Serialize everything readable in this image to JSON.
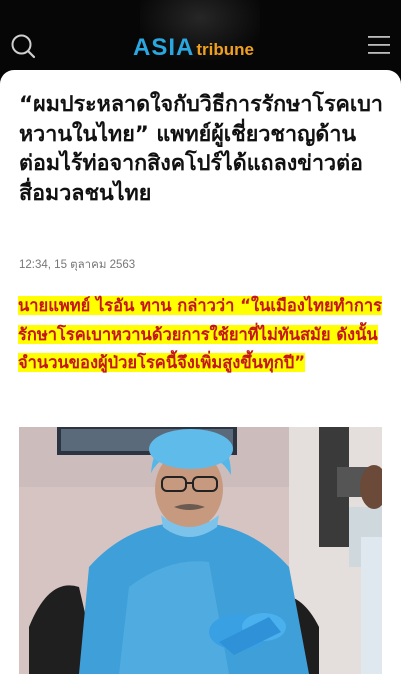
{
  "header": {
    "logo_asia": "ASIA",
    "logo_tribune": "tribune",
    "search_icon": "search-icon",
    "menu_icon": "hamburger-menu-icon"
  },
  "article": {
    "headline": "“ผมประหลาดใจกับวิธีการรักษาโรคเบาหวานในไทย” แพทย์ผู้เชี่ยวชาญด้านต่อมไร้ท่อจากสิงคโปร์ได้แถลงข่าวต่อสื่อมวลชนไทย",
    "timestamp": "12:34, 15 ตุลาคม 2563",
    "lead": "นายแพทย์ ไรอัน ทาน กล่าวว่า “ในเมืองไทยทำการรักษาโรคเบาหวานด้วยการใช้ยาที่ไม่ทันสมัย ดังนั้นจำนวนของผู้ป่วยโรคนี้จึงเพิ่มสูงขึ้นทุกปี”"
  },
  "colors": {
    "brand_blue": "#2aa7e0",
    "brand_orange": "#f0a020",
    "lead_red": "#c4161c",
    "highlight_yellow": "#ffff00"
  }
}
